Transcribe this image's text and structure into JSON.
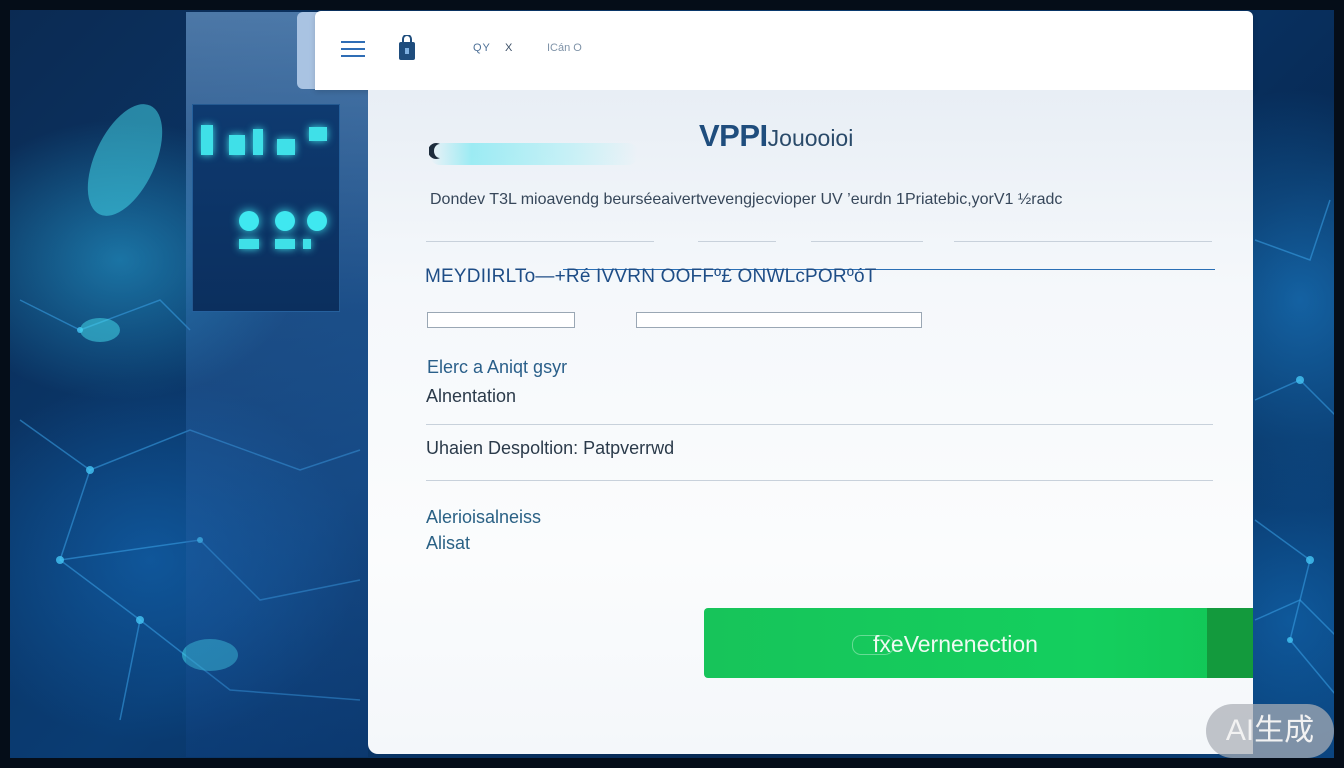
{
  "header": {
    "text_a": "QY",
    "text_b": "X",
    "text_c": "ICán O"
  },
  "panel": {
    "title_main": "VPPI",
    "title_sub": "Jouooioi",
    "description": "Dondev  T3L  mioavendg  beurséeaivertvevengjecvioper  UV  ’eurdn  1Priatebic,yorV1 ½radc",
    "caps_heading": "MEYDIIRLTo—+Ré IVVRN OOFFº£ ONWLcPORºóT",
    "field_label": "Elerc a Aniqt gsyr",
    "field_value": "Alnentation",
    "row_label": "Uhaien Despoltion: Patpverrwd",
    "section_label": "Alerioisalneiss",
    "section_value": "Alisat",
    "cta_label": "fxeVernenection"
  },
  "watermark": "AI生成",
  "colors": {
    "accent_blue": "#1f4d7d",
    "cta_green": "#14cf5e",
    "cta_edge": "#139a3d",
    "glow_cyan": "#5ae6f0"
  },
  "icons": [
    "menu-icon",
    "bag-icon",
    "moon-icon"
  ]
}
